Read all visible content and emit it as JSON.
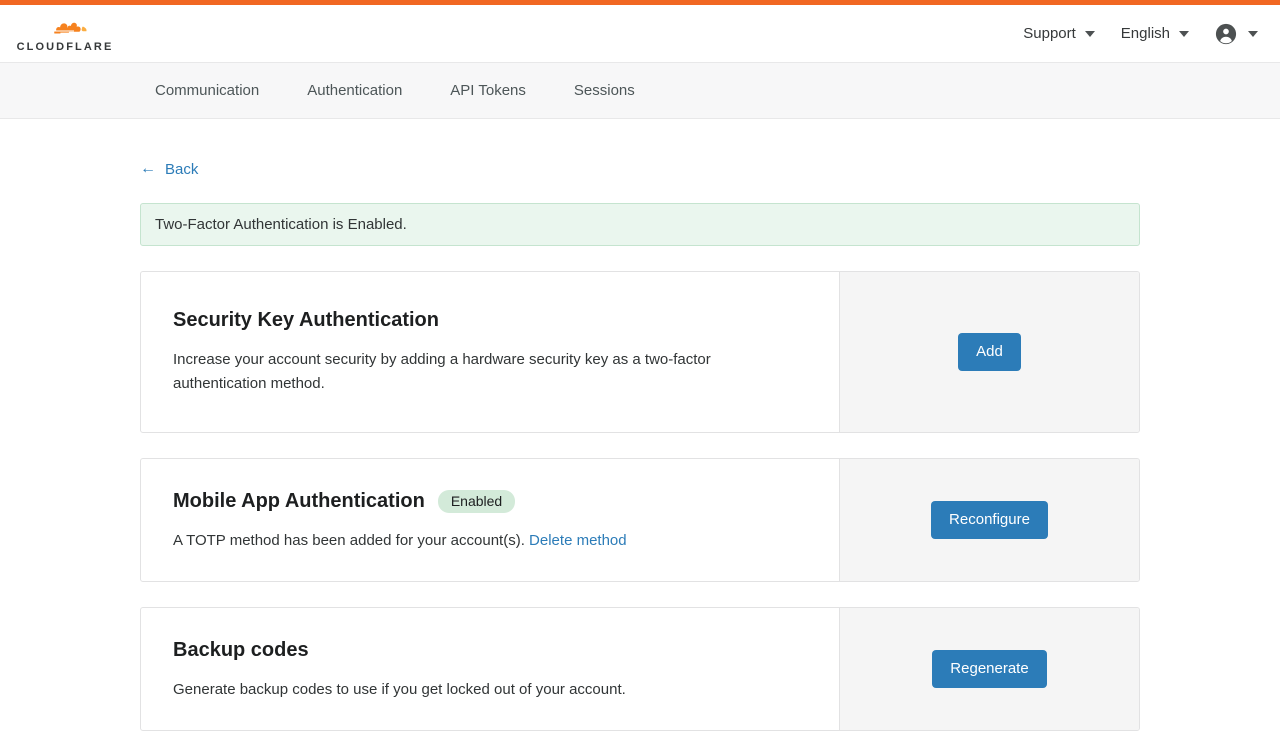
{
  "brand": {
    "name": "CLOUDFLARE",
    "logo_icon": "cloudflare-cloud-icon",
    "accent_color": "#f16722"
  },
  "header": {
    "support_label": "Support",
    "language_label": "English",
    "account_icon": "account-circle-icon",
    "caret_icon": "chevron-down-icon"
  },
  "subnav": {
    "items": [
      {
        "label": "Communication"
      },
      {
        "label": "Authentication"
      },
      {
        "label": "API Tokens"
      },
      {
        "label": "Sessions"
      }
    ]
  },
  "main": {
    "back": {
      "label": "Back",
      "icon": "arrow-left-icon",
      "color": "#2c7cb8"
    },
    "alert": {
      "message": "Two-Factor Authentication is Enabled.",
      "background": "#eaf6ee",
      "border": "#c5e4cf"
    },
    "cards": [
      {
        "title": "Security Key Authentication",
        "description": "Increase your account security by adding a hardware security key as a two-factor authentication method.",
        "badge": null,
        "link": null,
        "button": "Add"
      },
      {
        "title": "Mobile App Authentication",
        "description": "A TOTP method has been added for your account(s). ",
        "badge": "Enabled",
        "link": "Delete method",
        "button": "Reconfigure"
      },
      {
        "title": "Backup codes",
        "description": "Generate backup codes to use if you get locked out of your account.",
        "badge": null,
        "link": null,
        "button": "Regenerate"
      }
    ]
  },
  "colors": {
    "primary_button": "#2c7cb8",
    "link": "#2c7cb8",
    "badge_bg": "#d3ead9",
    "panel_bg": "#f5f5f5"
  }
}
